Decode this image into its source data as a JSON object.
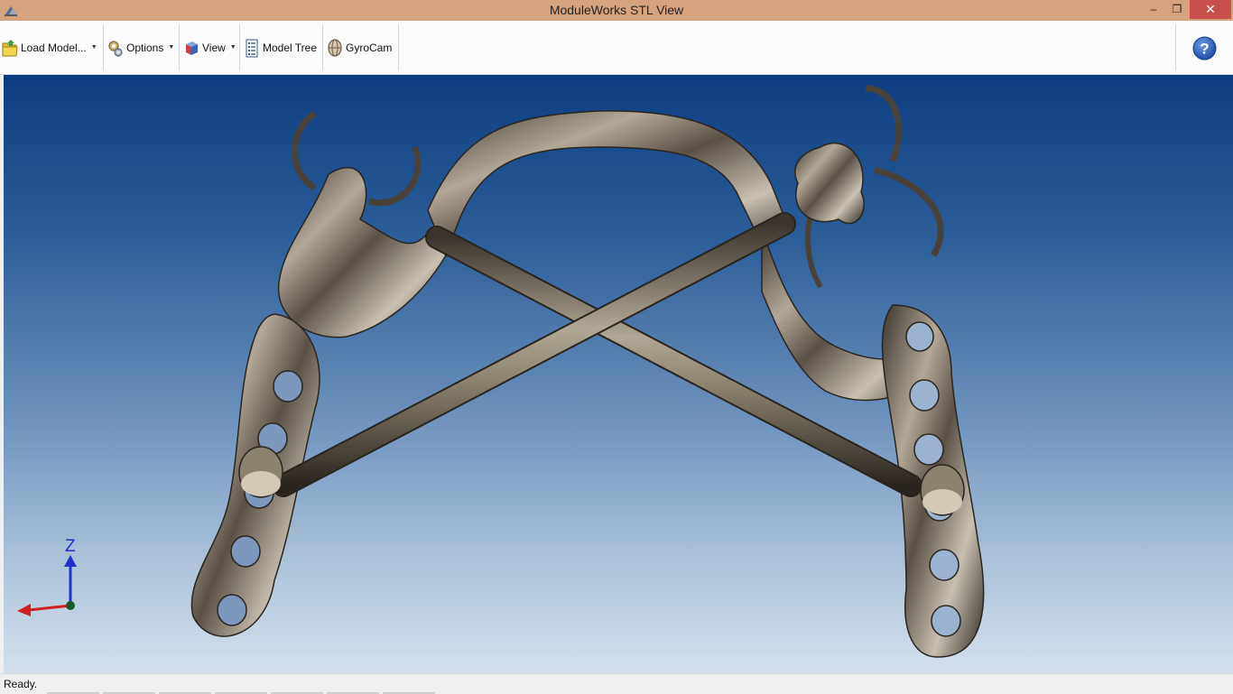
{
  "window": {
    "title": "ModuleWorks STL View",
    "minimize_glyph": "‒",
    "restore_glyph": "❐",
    "close_glyph": "✕"
  },
  "toolbar": {
    "items": [
      {
        "label": "Load Model...",
        "icon": "folder-icon",
        "has_dropdown": true
      },
      {
        "label": "Options",
        "icon": "gears-icon",
        "has_dropdown": true
      },
      {
        "label": "View",
        "icon": "cube-view-icon",
        "has_dropdown": true
      },
      {
        "label": "Model Tree",
        "icon": "tree-icon",
        "has_dropdown": false
      },
      {
        "label": "GyroCam",
        "icon": "gyrocam-icon",
        "has_dropdown": false
      }
    ],
    "help_icon": "help-icon"
  },
  "viewport": {
    "axis": {
      "z_label": "Z"
    }
  },
  "status": {
    "text": "Ready."
  },
  "colors": {
    "titlebar": "#d7a37c",
    "close_button": "#c7504b",
    "viewport_top": "#0c3d80",
    "viewport_bottom": "#d4e0ec",
    "axis_z": "#1f2fd0",
    "axis_x": "#d02020"
  }
}
